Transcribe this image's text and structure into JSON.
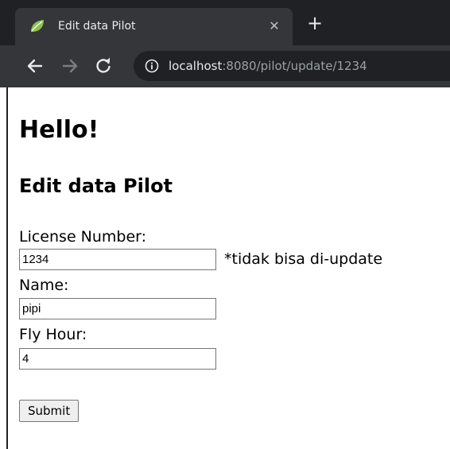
{
  "browser": {
    "tab": {
      "title": "Edit data Pilot",
      "favicon": "spring-leaf-icon",
      "close_glyph": "✕"
    },
    "new_tab_glyph": "+",
    "nav": {
      "back": "back-arrow-icon",
      "forward": "forward-arrow-icon",
      "reload": "reload-icon"
    },
    "address": {
      "host": "localhost",
      "rest": ":8080/pilot/update/1234"
    },
    "colors": {
      "tabstrip": "#202124",
      "toolbar": "#35363a",
      "favicon": "#8bc34a"
    }
  },
  "page": {
    "greeting": "Hello!",
    "title": "Edit data Pilot",
    "form": {
      "license": {
        "label": "License Number:",
        "value": "1234",
        "note": "*tidak bisa di-update"
      },
      "name": {
        "label": "Name:",
        "value": "pipi"
      },
      "fly_hour": {
        "label": "Fly Hour:",
        "value": "4"
      },
      "submit_label": "Submit"
    }
  }
}
